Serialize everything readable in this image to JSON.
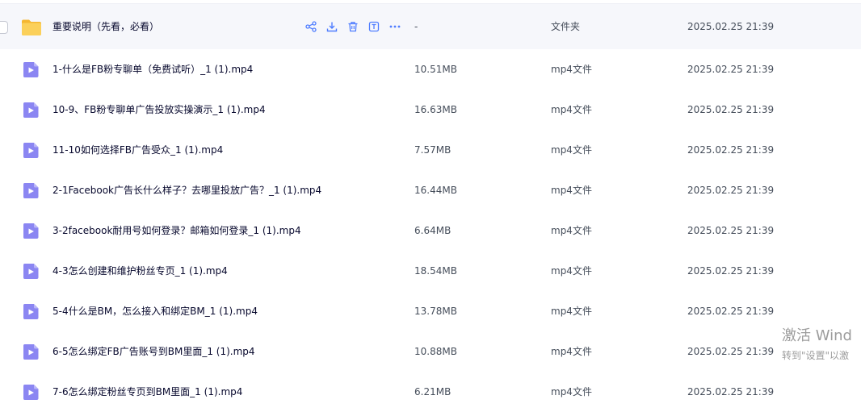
{
  "folder": {
    "name": "重要说明（先看，必看）",
    "size": "-",
    "type": "文件夹",
    "time": "2025.02.25 21:39"
  },
  "files": [
    {
      "name": "1-什么是FB粉专聊单（免费试听）_1 (1).mp4",
      "size": "10.51MB",
      "type": "mp4文件",
      "time": "2025.02.25 21:39"
    },
    {
      "name": "10-9、FB粉专聊单广告投放实操演示_1 (1).mp4",
      "size": "16.63MB",
      "type": "mp4文件",
      "time": "2025.02.25 21:39"
    },
    {
      "name": "11-10如何选择FB广告受众_1 (1).mp4",
      "size": "7.57MB",
      "type": "mp4文件",
      "time": "2025.02.25 21:39"
    },
    {
      "name": "2-1Facebook广告长什么样子？去哪里投放广告？_1 (1).mp4",
      "size": "16.44MB",
      "type": "mp4文件",
      "time": "2025.02.25 21:39"
    },
    {
      "name": "3-2facebook耐用号如何登录？邮箱如何登录_1 (1).mp4",
      "size": "6.64MB",
      "type": "mp4文件",
      "time": "2025.02.25 21:39"
    },
    {
      "name": "4-3怎么创建和维护粉丝专页_1 (1).mp4",
      "size": "18.54MB",
      "type": "mp4文件",
      "time": "2025.02.25 21:39"
    },
    {
      "name": "5-4什么是BM，怎么接入和绑定BM_1 (1).mp4",
      "size": "13.78MB",
      "type": "mp4文件",
      "time": "2025.02.25 21:39"
    },
    {
      "name": "6-5怎么绑定FB广告账号到BM里面_1 (1).mp4",
      "size": "10.88MB",
      "type": "mp4文件",
      "time": "2025.02.25 21:39"
    },
    {
      "name": "7-6怎么绑定粉丝专页到BM里面_1 (1).mp4",
      "size": "6.21MB",
      "type": "mp4文件",
      "time": "2025.02.25 21:39"
    }
  ],
  "watermark": {
    "line1": "激活 Wind",
    "line2": "转到\"设置\"以激"
  },
  "colors": {
    "video_icon": "#8b86f2",
    "folder_icon": "#f8c740",
    "action_icon": "#4f7dff"
  }
}
